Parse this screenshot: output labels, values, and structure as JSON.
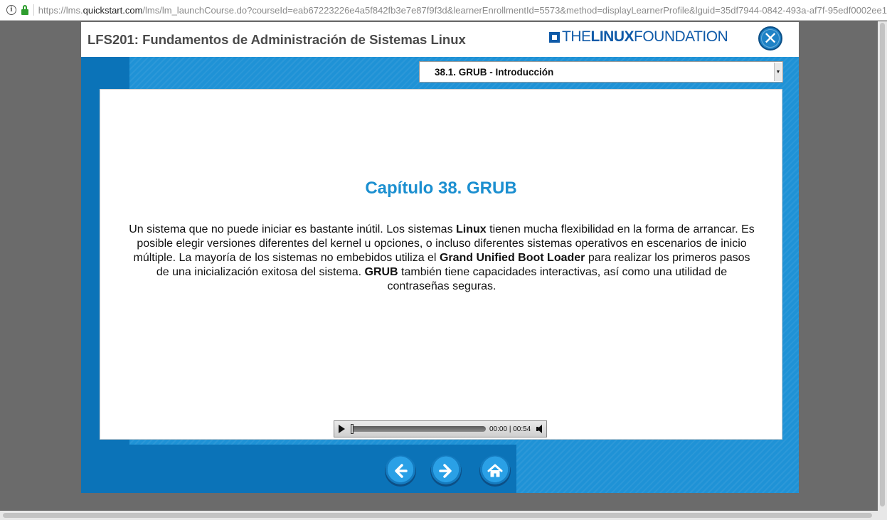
{
  "browser": {
    "url_prefix": "https://lms.",
    "url_host": "quickstart.com",
    "url_rest": "/lms/lm_launchCourse.do?courseId=eab67223226e4a5f842fb3e7e87f9f3d&learnerEnrollmentId=5573&method=displayLearnerProfile&lguid=35df7944-0842-493a-af7f-95edf0002ee1",
    "info_icon": "info-icon",
    "lock_icon": "lock-icon"
  },
  "header": {
    "course_title": "LFS201: Fundamentos de Administración de Sistemas Linux",
    "logo_the": "THE",
    "logo_linux": "LINUX",
    "logo_foundation": "FOUNDATION",
    "close_glyph": "✕"
  },
  "section_select": {
    "selected": "38.1. GRUB - Introducción",
    "arrow_glyph": "▼"
  },
  "content": {
    "chapter_title": "Capítulo 38. GRUB",
    "p1": "Un sistema que no puede iniciar es bastante inútil. Los sistemas ",
    "b1": "Linux",
    "p2": " tienen mucha flexibilidad en la forma de arrancar. Es posible elegir versiones diferentes del kernel u opciones, o incluso diferentes sistemas operativos en escenarios de inicio múltiple. La mayoría de los sistemas no embebidos utiliza el ",
    "b2": "Grand Unified Boot Loader",
    "p3": " para realizar los primeros pasos de una inicialización exitosa del sistema. ",
    "b3": "GRUB",
    "p4": " también tiene capacidades interactivas, así como una utilidad de contraseñas seguras."
  },
  "audio": {
    "current": "00:00",
    "separator": "|",
    "duration": "00:54",
    "progress": 0
  },
  "nav": {
    "back_icon": "arrow-left-icon",
    "next_icon": "arrow-right-icon",
    "home_icon": "home-icon"
  },
  "colors": {
    "brand_blue": "#1f92d6",
    "title_blue": "#1b8fd0",
    "logo_blue": "#0f5aa8"
  }
}
